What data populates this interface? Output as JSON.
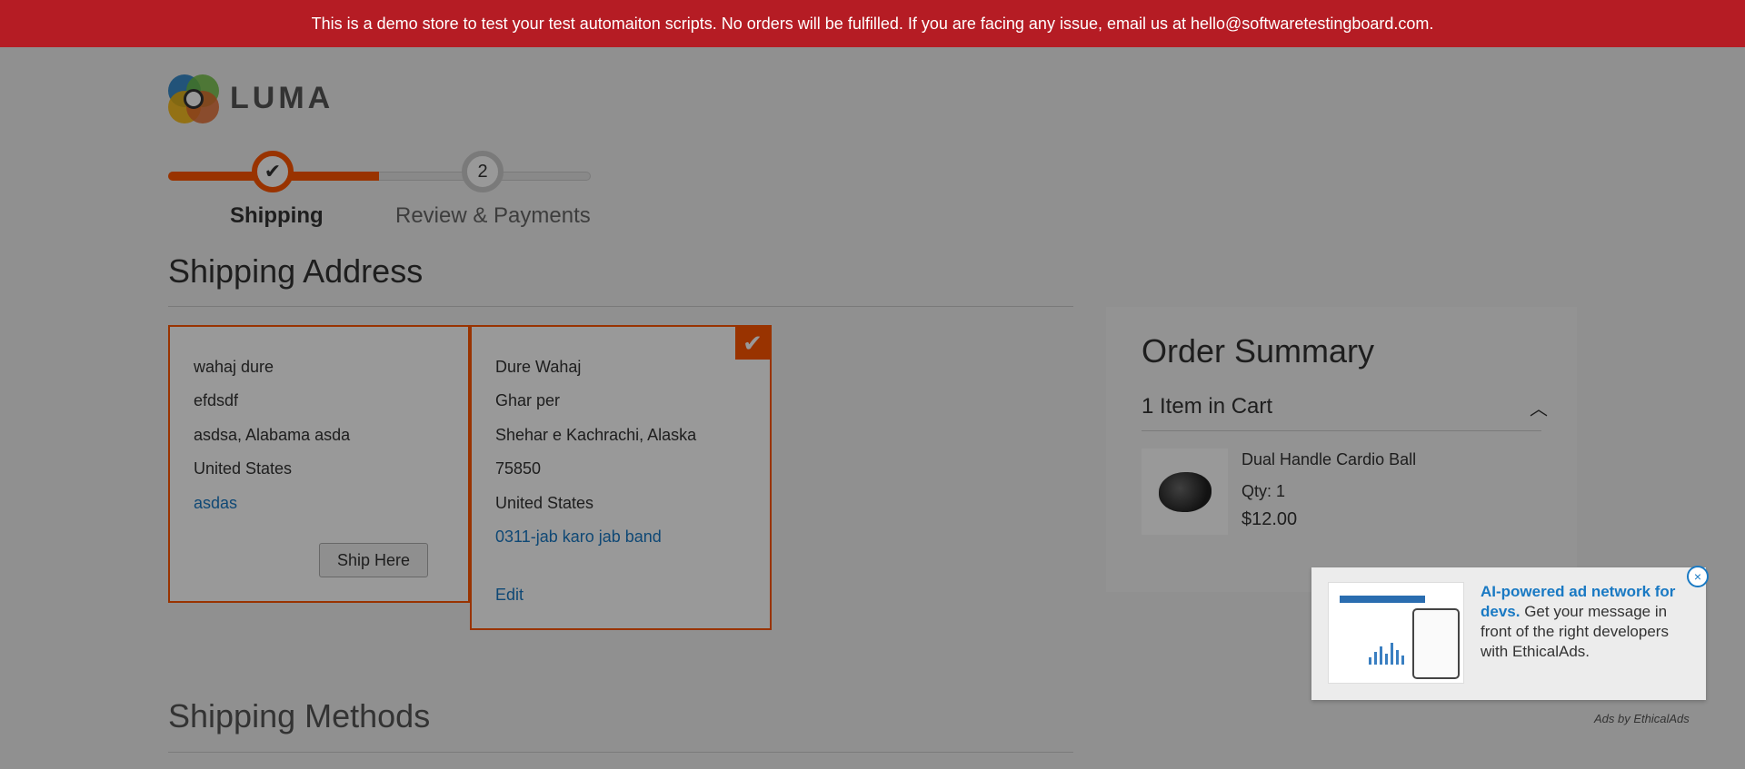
{
  "banner": {
    "text": "This is a demo store to test your test automaiton scripts. No orders will be fulfilled. If you are facing any issue, email us at hello@softwaretestingboard.com."
  },
  "logo": {
    "text": "LUMA"
  },
  "progress": {
    "steps": [
      {
        "label": "Shipping",
        "state": "complete",
        "icon": "check-icon"
      },
      {
        "label": "Review & Payments",
        "number": "2",
        "state": "pending"
      }
    ]
  },
  "shipping": {
    "title": "Shipping Address",
    "addresses": [
      {
        "name": "wahaj dure",
        "street": "efdsdf",
        "city_region": "asdsa, Alabama asda",
        "country": "United States",
        "phone": "asdas",
        "action": "Ship Here",
        "selected": false
      },
      {
        "name": "Dure Wahaj",
        "street": "Ghar per",
        "city_region": "Shehar e Kachrachi, Alaska",
        "postcode": "75850",
        "country": "United States",
        "phone": "0311-jab karo jab band",
        "action": "Edit",
        "selected": true
      }
    ]
  },
  "methods": {
    "title": "Shipping Methods"
  },
  "summary": {
    "title": "Order Summary",
    "cart_count": "1 Item in Cart",
    "items": [
      {
        "name": "Dual Handle Cardio Ball",
        "qty": "Qty: 1",
        "price": "$12.00"
      }
    ]
  },
  "ad": {
    "headline": "AI-powered ad network for devs.",
    "body": " Get your message in front of the right developers with EthicalAds.",
    "close": "×",
    "by": "Ads by EthicalAds"
  },
  "colors": {
    "banner": "#b51c24",
    "accent": "#ff5501",
    "link": "#1979c3"
  }
}
